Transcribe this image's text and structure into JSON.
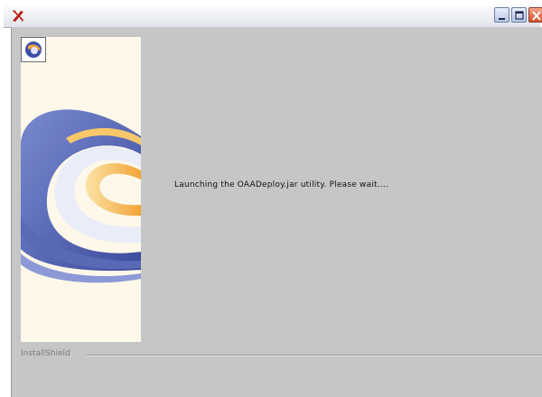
{
  "window": {
    "title": "",
    "controls": {
      "minimize_icon": "minimize-icon",
      "maximize_icon": "maximize-icon",
      "close_icon": "close-icon"
    }
  },
  "content": {
    "message": "Launching the OAADeploy.jar utility.  Please wait....",
    "footer_brand": "InstallShield"
  },
  "colors": {
    "title_bar": "#eceef3",
    "client_background": "#c6c6c6",
    "banner_background": "#fdf8ea",
    "banner_blue": "#4a5ba8",
    "banner_orange": "#f3a93a",
    "close_button": "#d4502c"
  }
}
